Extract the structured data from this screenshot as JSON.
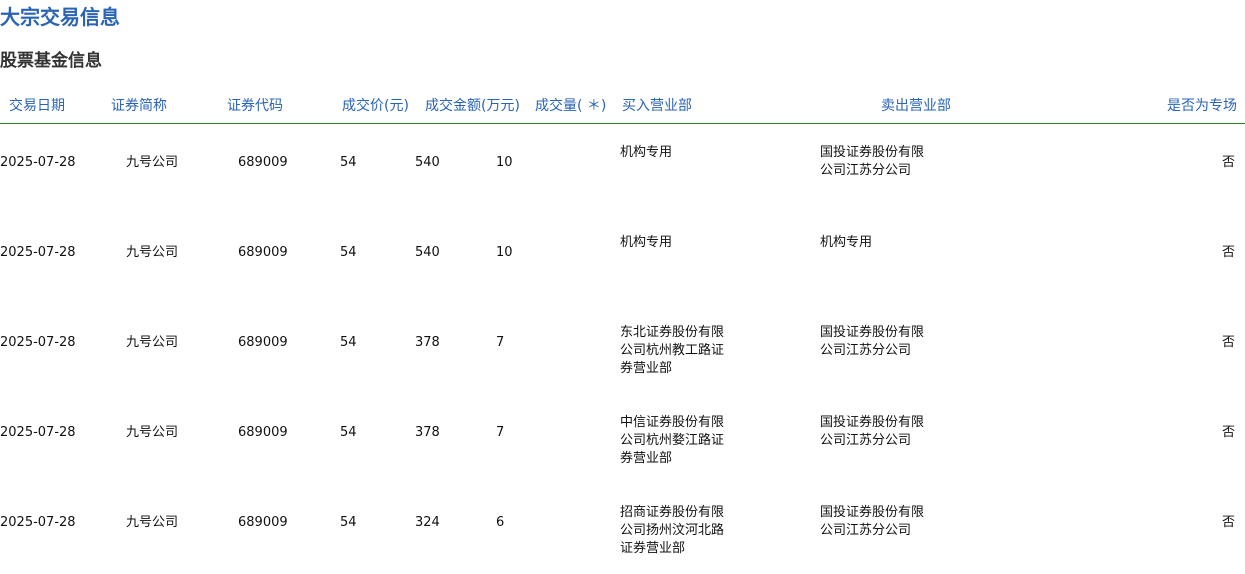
{
  "page": {
    "title": "大宗交易信息",
    "section_title": "股票基金信息"
  },
  "table": {
    "headers": {
      "date": "交易日期",
      "name": "证券简称",
      "code": "证券代码",
      "price": "成交价(元)",
      "amount": "成交金额(万元)",
      "volume": "成交量( ＊)",
      "buyer": "买入营业部",
      "seller": "卖出营业部",
      "special": "是否为专场"
    },
    "rows": [
      {
        "date": "2025-07-28",
        "name": "九号公司",
        "code": "689009",
        "price": "54",
        "amount": "540",
        "volume": "10",
        "buyer": "机构专用",
        "seller": "国投证券股份有限公司江苏分公司",
        "special": "否"
      },
      {
        "date": "2025-07-28",
        "name": "九号公司",
        "code": "689009",
        "price": "54",
        "amount": "540",
        "volume": "10",
        "buyer": "机构专用",
        "seller": "机构专用",
        "special": "否"
      },
      {
        "date": "2025-07-28",
        "name": "九号公司",
        "code": "689009",
        "price": "54",
        "amount": "378",
        "volume": "7",
        "buyer": "东北证券股份有限公司杭州教工路证券营业部",
        "seller": "国投证券股份有限公司江苏分公司",
        "special": "否"
      },
      {
        "date": "2025-07-28",
        "name": "九号公司",
        "code": "689009",
        "price": "54",
        "amount": "378",
        "volume": "7",
        "buyer": "中信证券股份有限公司杭州婺江路证券营业部",
        "seller": "国投证券股份有限公司江苏分公司",
        "special": "否"
      },
      {
        "date": "2025-07-28",
        "name": "九号公司",
        "code": "689009",
        "price": "54",
        "amount": "324",
        "volume": "6",
        "buyer": "招商证券股份有限公司扬州汶河北路证券营业部",
        "seller": "国投证券股份有限公司江苏分公司",
        "special": "否"
      }
    ]
  }
}
